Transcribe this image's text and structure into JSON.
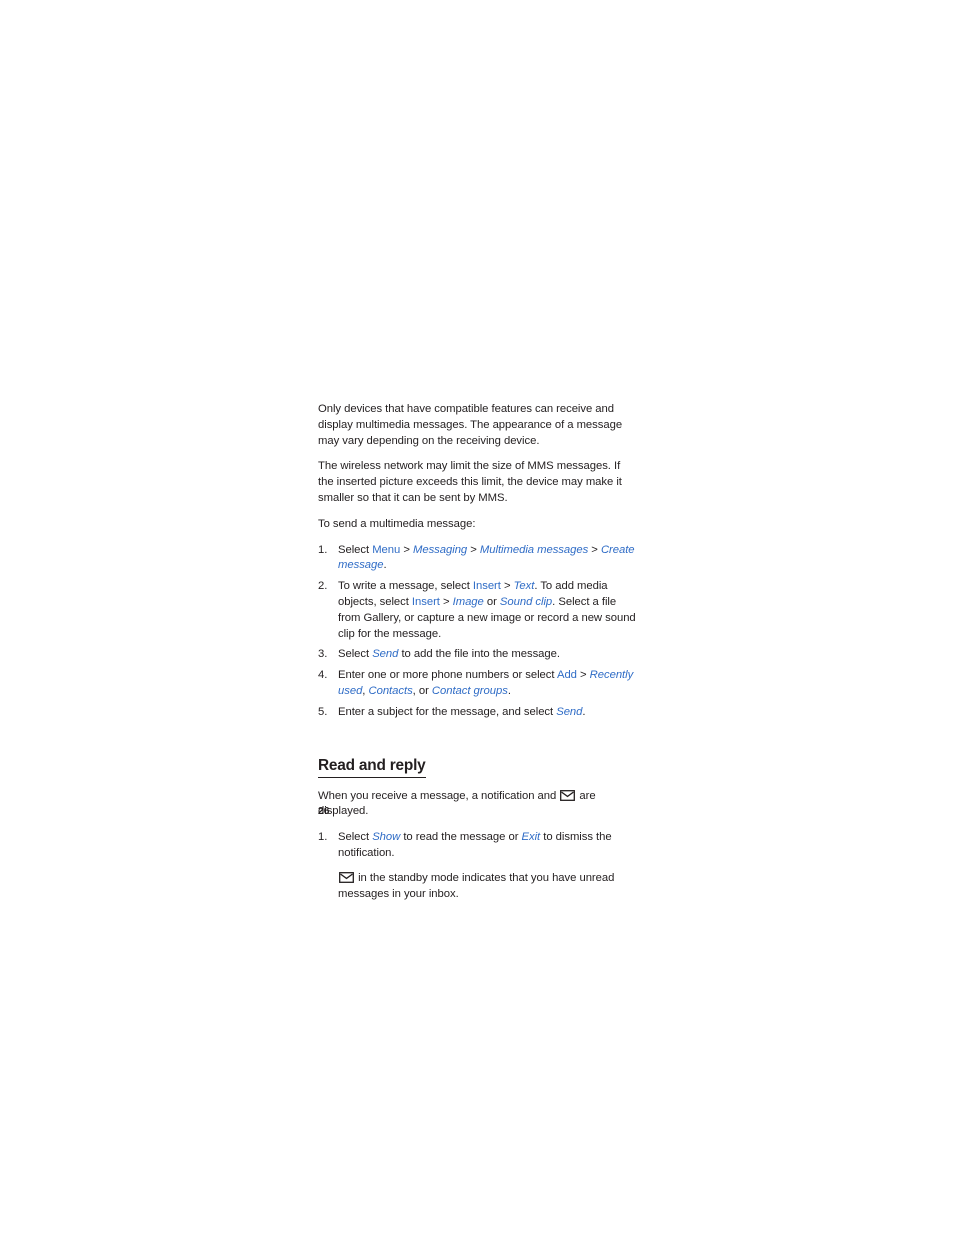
{
  "page": {
    "folio": "26",
    "background": "#ffffff",
    "text_color": "#231f20",
    "ui_accent_color": "#2f6cc6"
  },
  "icons": {
    "envelope": "envelope-icon"
  },
  "paragraphs": {
    "compatible_devices": "Only devices that have compatible features can receive and display multimedia messages. The appearance of a message may vary depending on the receiving device.",
    "network_limit": "The wireless network may limit the size of MMS messages. If the inserted picture exceeds this limit, the device may make it smaller so that it can be sent by MMS.",
    "to_send_intro": "To send a multimedia message:"
  },
  "send_steps": [
    {
      "num": "1.",
      "parts": [
        {
          "t": "Select ",
          "s": "plain"
        },
        {
          "t": "Menu",
          "s": "ui"
        },
        {
          "t": " > ",
          "s": "plain"
        },
        {
          "t": "Messaging",
          "s": "ui-i"
        },
        {
          "t": " > ",
          "s": "plain"
        },
        {
          "t": "Multimedia messages",
          "s": "ui-i"
        },
        {
          "t": " > ",
          "s": "plain"
        },
        {
          "t": "Create message",
          "s": "ui-i"
        },
        {
          "t": ".",
          "s": "plain"
        }
      ]
    },
    {
      "num": "2.",
      "parts": [
        {
          "t": "To write a message, select ",
          "s": "plain"
        },
        {
          "t": "Insert",
          "s": "ui"
        },
        {
          "t": " > ",
          "s": "plain"
        },
        {
          "t": "Text",
          "s": "ui-i"
        },
        {
          "t": ". To add media objects, select ",
          "s": "plain"
        },
        {
          "t": "Insert",
          "s": "ui"
        },
        {
          "t": " > ",
          "s": "plain"
        },
        {
          "t": "Image",
          "s": "ui-i"
        },
        {
          "t": " or ",
          "s": "plain"
        },
        {
          "t": "Sound clip",
          "s": "ui-i"
        },
        {
          "t": ". Select a file from Gallery, or capture a new image or record a new sound clip for the message.",
          "s": "plain"
        }
      ]
    },
    {
      "num": "3.",
      "parts": [
        {
          "t": "Select ",
          "s": "plain"
        },
        {
          "t": "Send",
          "s": "ui-i"
        },
        {
          "t": " to add the file into the message.",
          "s": "plain"
        }
      ]
    },
    {
      "num": "4.",
      "parts": [
        {
          "t": "Enter one or more phone numbers or select ",
          "s": "plain"
        },
        {
          "t": "Add",
          "s": "ui"
        },
        {
          "t": " > ",
          "s": "plain"
        },
        {
          "t": "Recently used",
          "s": "ui-i"
        },
        {
          "t": ", ",
          "s": "plain"
        },
        {
          "t": "Contacts",
          "s": "ui-i"
        },
        {
          "t": ", or ",
          "s": "plain"
        },
        {
          "t": "Contact groups",
          "s": "ui-i"
        },
        {
          "t": ".",
          "s": "plain"
        }
      ]
    },
    {
      "num": "5.",
      "parts": [
        {
          "t": "Enter a subject for the message, and select ",
          "s": "plain"
        },
        {
          "t": "Send",
          "s": "ui-i"
        },
        {
          "t": ".",
          "s": "plain"
        }
      ]
    }
  ],
  "read_and_reply": {
    "heading": "Read and reply",
    "intro_before_icon": "When you receive a message, a notification and ",
    "intro_after_icon": " are displayed.",
    "steps": [
      {
        "num": "1.",
        "parts": [
          {
            "t": "Select ",
            "s": "plain"
          },
          {
            "t": "Show",
            "s": "ui-i"
          },
          {
            "t": " to read the message or ",
            "s": "plain"
          },
          {
            "t": "Exit",
            "s": "ui-i"
          },
          {
            "t": " to dismiss the notification.",
            "s": "plain"
          }
        ]
      }
    ],
    "note_after_icon": " in the standby mode indicates that you have unread messages in your inbox."
  }
}
